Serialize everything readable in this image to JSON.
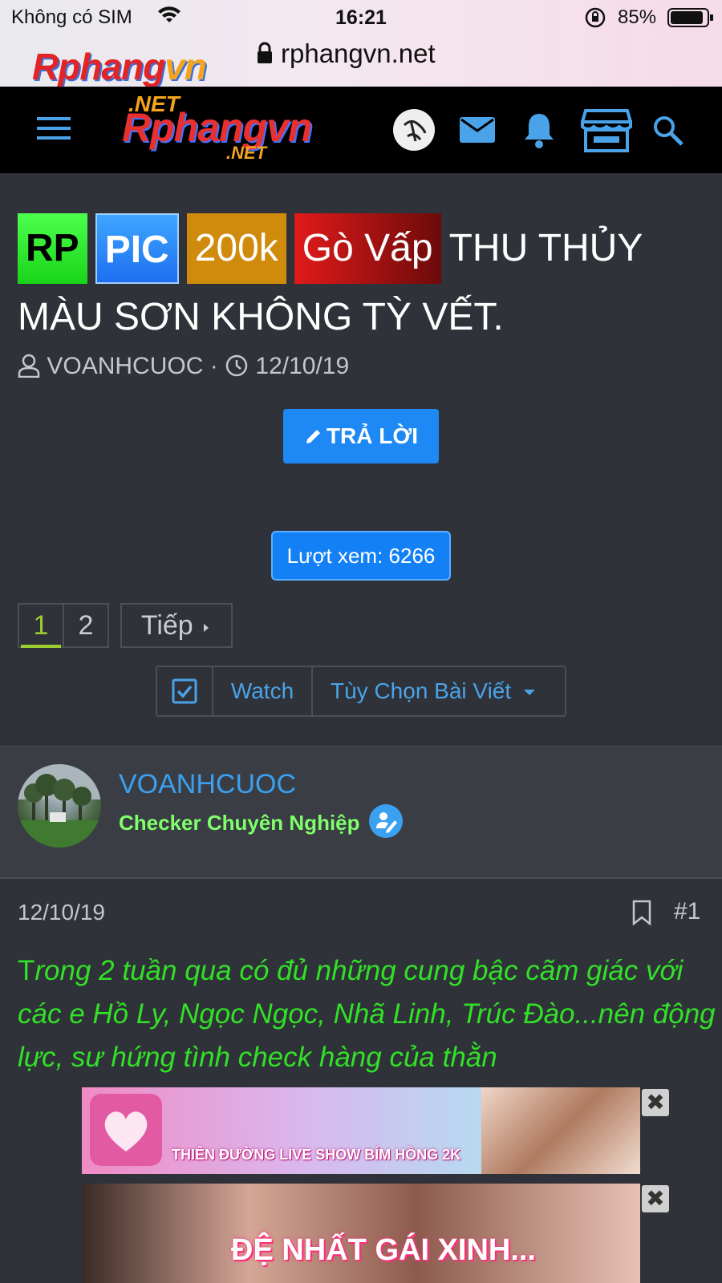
{
  "status_bar": {
    "carrier": "Không có SIM",
    "time": "16:21",
    "battery": "85%"
  },
  "browser": {
    "url": "rphangvn.net",
    "overlay_logo": {
      "part1": "Rphang",
      "part2": "vn"
    }
  },
  "header": {
    "logo": {
      "net_top": ".NET",
      "name": "Rphangvn",
      "net_bottom": ".NET"
    },
    "icons": [
      "menu-icon",
      "avatar",
      "mail-icon",
      "bell-icon",
      "store-icon",
      "search-icon"
    ],
    "accent": "#4aa3e8"
  },
  "thread": {
    "labels": [
      "RP",
      "PIC",
      "200k",
      "Gò Vấp"
    ],
    "title": "THU THỦY MÀU SƠN KHÔNG TỲ VẾT.",
    "author": "VOANHCUOC",
    "separator": "·",
    "date": "12/10/19",
    "reply_button": "TRẢ LỜI",
    "views": "Lượt xem: 6266"
  },
  "pagination": {
    "pages": [
      "1",
      "2"
    ],
    "current": "1",
    "next": "Tiếp"
  },
  "toolbar": {
    "watch": "Watch",
    "options": "Tùy Chọn Bài Viết"
  },
  "post": {
    "author": "VOANHCUOC",
    "author_title": "Checker Chuyên Nghiệp",
    "date": "12/10/19",
    "number": "#1",
    "body_first_letter": "T",
    "body": "rong 2 tuần qua có đủ những cung bậc cãm giác với các e Hồ Ly, Ngọc Ngọc, Nhã Linh, Trúc Đào...nên động lực, sư hứng tình check hàng của thằn"
  },
  "ads": [
    {
      "text": "THIÊN ĐƯỜNG LIVE SHOW BÍM HỒNG 2K",
      "close": "✖"
    },
    {
      "text": "ĐỆ NHẤT GÁI XINH...",
      "close": "✖"
    }
  ],
  "colors": {
    "background": "#2f3238",
    "link": "#3aa0f0",
    "post_text": "#31e027",
    "button": "#1e88f5"
  }
}
